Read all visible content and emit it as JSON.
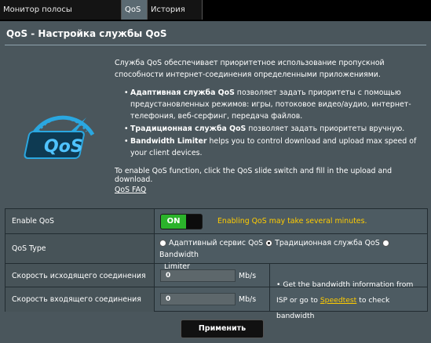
{
  "tabs": [
    {
      "label": "Монитор полосы пропускания"
    },
    {
      "label": "QoS"
    },
    {
      "label": "История веб"
    }
  ],
  "page_title": "QoS - Настройка службы QoS",
  "description": "Служба QoS обеспечивает приоритетное использование пропускной способности интернет-соединения определенными приложениями.",
  "bullets": [
    {
      "bold": "Адаптивная служба QoS",
      "text": " позволяет задать приоритеты с помощью предустановленных режимов: игры, потоковое видео/аудио, интернет-телефония, веб-серфинг, передача файлов."
    },
    {
      "bold": "Традиционная служба QoS",
      "text": " позволяет задать приоритеты вручную."
    },
    {
      "bold": "Bandwidth Limiter",
      "text": " helps you to control download and upload max speed of your client devices."
    }
  ],
  "enable_instructions": "To enable QoS function, click the QoS slide switch and fill in the upload and download.",
  "faq_link": "QoS FAQ",
  "logo_text": "QoS",
  "settings": {
    "enable_qos": {
      "label": "Enable QoS",
      "state": "ON",
      "note": "Enabling QoS may take several minutes."
    },
    "qos_type": {
      "label": "QoS Type",
      "options": [
        "Адаптивный сервис QoS",
        "Традиционная служба QoS",
        "Bandwidth",
        "Limiter"
      ],
      "selected": "Традиционная служба QoS"
    },
    "upload": {
      "label": "Скорость исходящего соединения",
      "value": "0",
      "unit": "Mb/s"
    },
    "download": {
      "label": "Скорость входящего соединения",
      "value": "0",
      "unit": "Mb/s"
    },
    "info": {
      "before": "Get the bandwidth information from ISP or go to ",
      "link": "Speedtest",
      "after": " to check bandwidth"
    }
  },
  "apply_button": "Применить",
  "colors": {
    "accent_yellow": "#ffcc00",
    "toggle_green": "#2bb32b",
    "logo_blue": "#2aa7e0"
  }
}
